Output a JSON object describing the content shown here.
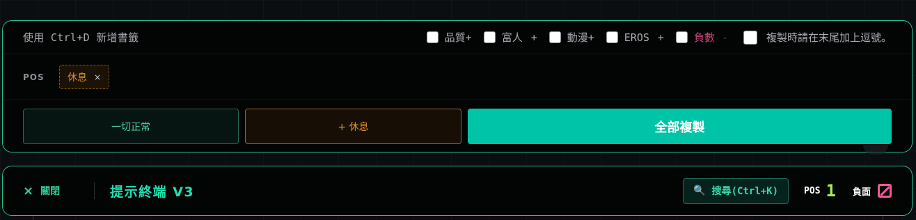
{
  "panel": {
    "hint": "使用 Ctrl+D 新增書籤",
    "options": [
      {
        "label": "品質+",
        "suffix": ""
      },
      {
        "label": "富人",
        "suffix": "+"
      },
      {
        "label": "動漫+",
        "suffix": ""
      },
      {
        "label": "EROS",
        "suffix": "+"
      },
      {
        "label": "負數",
        "suffix": "-"
      }
    ],
    "comma_option": "複製時請在末尾加上逗號。",
    "pos_label": "POS",
    "tag": {
      "label": "休息",
      "remove": "×"
    },
    "buttons": {
      "ok": "一切正常",
      "rest": "+ 休息",
      "copy": "全部複製"
    }
  },
  "bar": {
    "close_icon": "×",
    "close_label": "關閉",
    "title": "提示終端 V3",
    "search_label": "搜尋(Ctrl+K)",
    "pos_label": "POS",
    "pos_count": "1",
    "neg_label": "負面"
  },
  "colors": {
    "accent": "#24c08f",
    "copy_button": "#00c4a7",
    "rest_orange": "#e0922d",
    "negative_pink": "#f05a99",
    "pos_green": "#a6ef4d"
  },
  "icons": {
    "close": "close-icon",
    "search": "search-icon",
    "negative": "negative-box-icon"
  }
}
